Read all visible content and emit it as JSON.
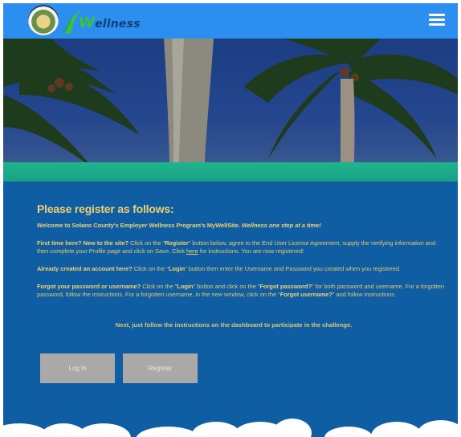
{
  "header": {
    "logo_text_prefix": "W",
    "logo_text_rest": "ellness"
  },
  "content": {
    "heading": "Please register as follows:",
    "welcome": {
      "text": "Welcome to Solano County's Employer Wellness Program's MyWellSite.",
      "emphasis": "Wellness one step at a time!"
    },
    "first_time": {
      "lead": "First time here? New to the site?",
      "text_a": " Click on the \"",
      "register_word": "Register",
      "text_b": "\" button below, agree to the End User License Agreement, supply the verifying information and then complete your Profile page and click on Save.  Click ",
      "link_here": "here",
      "text_c": " for instructions. You are now registered!"
    },
    "already": {
      "lead": "Already created an account here?",
      "text_a": " Click on the \"",
      "login_word": "Login",
      "text_b": "\" button then enter the Username and Password you created when you registered."
    },
    "forgot": {
      "lead": "Forgot your password or username?",
      "text_a": " Click on the \"",
      "login_word": "Login",
      "text_b": "\" button and click on the \"",
      "forgot_pw": "Forgot password?",
      "text_c": "\" for both password and username. For a forgotten password, follow the instructions. For a forgotten username, in the new window, click on the \"",
      "forgot_un": "Forgot username?",
      "text_d": "\" and follow instructions."
    },
    "next_line": "Next,  just follow the instructions on the dashboard to participate in the challenge."
  },
  "buttons": {
    "login_label": "Log In",
    "register_label": "Register"
  },
  "icons": {
    "menu": "hamburger-menu-icon",
    "seal": "county-seal-logo",
    "leaf": "leaf-icon"
  },
  "colors": {
    "header_bg": "#2c8ff0",
    "page_bg": "#0f5ea4",
    "text_gold": "#e3c46c",
    "band_green": "#1fb58e",
    "button_gray": "#a9a9a9"
  }
}
